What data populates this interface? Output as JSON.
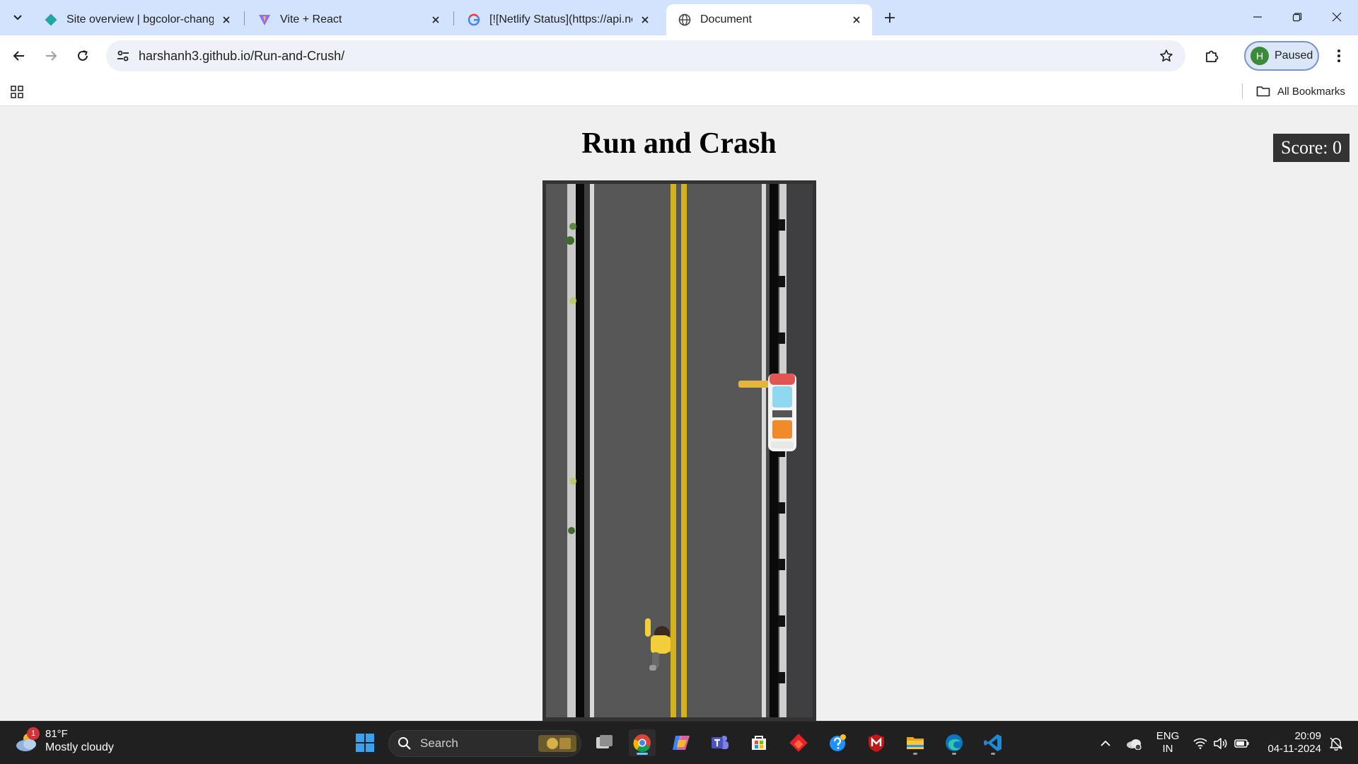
{
  "browser": {
    "tabs": [
      {
        "title": "Site overview | bgcolor-changer",
        "favicon": "netlify-icon",
        "active": false
      },
      {
        "title": "Vite + React",
        "favicon": "vite-icon",
        "active": false
      },
      {
        "title": "[![Netlify Status](https://api.netlify",
        "favicon": "google-icon",
        "active": false
      },
      {
        "title": "Document",
        "favicon": "globe-icon",
        "active": true
      }
    ],
    "url_host": "harshanh3.github.io",
    "url_path": "/Run-and-Crush/",
    "profile_initial": "H",
    "profile_status": "Paused",
    "all_bookmarks_label": "All Bookmarks"
  },
  "page": {
    "title": "Run and Crash",
    "score_label": "Score: 0",
    "game": {
      "objects": [
        "road",
        "lane-lines",
        "sidewalks",
        "runner",
        "car"
      ]
    }
  },
  "taskbar": {
    "weather": {
      "temp": "81°F",
      "condition": "Mostly cloudy",
      "badge": "1"
    },
    "search_label": "Search",
    "language_top": "ENG",
    "language_bottom": "IN",
    "time": "20:09",
    "date": "04-11-2024",
    "pinned": [
      "task-view-icon",
      "chrome-icon",
      "copilot-icon",
      "teams-icon",
      "store-icon",
      "git-app-icon",
      "help-icon",
      "mcafee-icon",
      "file-explorer-icon",
      "edge-icon",
      "vscode-icon"
    ]
  },
  "colors": {
    "tabstrip": "#d3e3fd",
    "road": "#4a4a4c",
    "lane_yellow": "#d4b21c",
    "canvas_border": "#333333",
    "accent": "#60cdff"
  }
}
